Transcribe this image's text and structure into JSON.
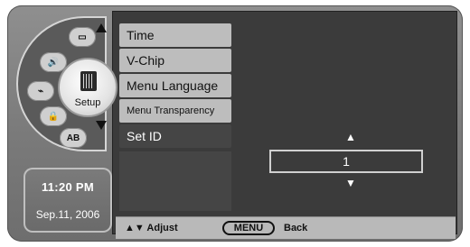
{
  "wheel": {
    "hub_label": "Setup",
    "segments": [
      {
        "name": "picture-icon",
        "text": "▭"
      },
      {
        "name": "audio-icon",
        "text": "🔊"
      },
      {
        "name": "channel-icon",
        "text": "⌁"
      },
      {
        "name": "lock-icon",
        "text": "🔒"
      },
      {
        "name": "input-icon",
        "text": "AB"
      },
      {
        "name": "info-icon",
        "text": "ⓘ"
      }
    ],
    "up_arrow": "▲",
    "down_arrow": "▼"
  },
  "clock": {
    "time": "11:20 PM",
    "date": "Sep.11, 2006"
  },
  "menu": {
    "items": [
      {
        "label": "Time"
      },
      {
        "label": "V-Chip"
      },
      {
        "label": "Menu Language"
      },
      {
        "label": "Menu Transparency"
      },
      {
        "label": "Set ID"
      }
    ],
    "selected_index": 4
  },
  "setid": {
    "value": "1",
    "up": "▲",
    "down": "▼"
  },
  "footer": {
    "adjust_label": "▲▼ Adjust",
    "menu_button": "MENU",
    "back_label": "Back"
  },
  "colors": {
    "panel": "#3b3b3b",
    "menu_item": "#bdbdbd",
    "menu_item_selected": "#454545",
    "footer": "#b9b9b9"
  }
}
